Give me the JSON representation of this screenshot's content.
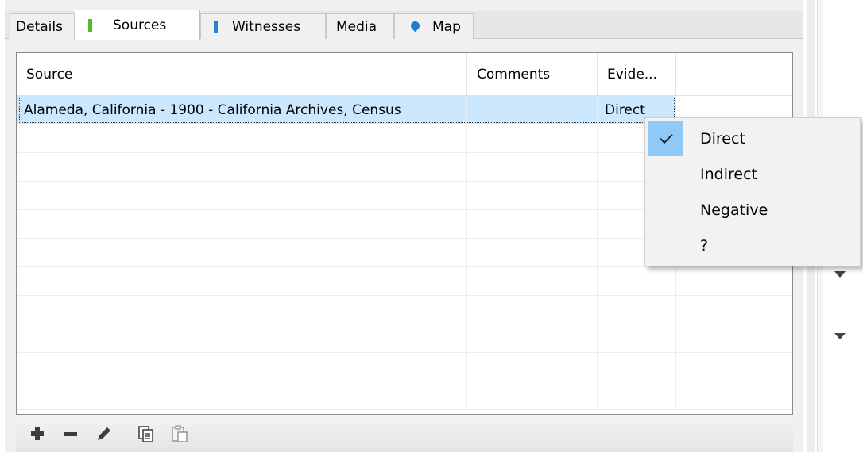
{
  "tabs": [
    {
      "label": "Details",
      "icon": "none",
      "active": false
    },
    {
      "label": "Sources",
      "icon": "green-bar-icon",
      "active": true
    },
    {
      "label": "Witnesses",
      "icon": "blue-bar-icon",
      "active": false
    },
    {
      "label": "Media",
      "icon": "none",
      "active": false
    },
    {
      "label": "Map",
      "icon": "map-pin-icon",
      "active": false
    }
  ],
  "grid": {
    "columns": [
      "Source",
      "Comments",
      "Evide..."
    ],
    "rows": [
      {
        "source": "Alameda, California - 1900 - California Archives, Census",
        "comments": "",
        "evidence": "Direct"
      }
    ]
  },
  "toolbar": {
    "icons": [
      "add-icon",
      "remove-icon",
      "edit-icon",
      "copy-icon",
      "paste-icon"
    ]
  },
  "popup_menu": {
    "items": [
      {
        "label": "Direct",
        "checked": true
      },
      {
        "label": "Indirect",
        "checked": false
      },
      {
        "label": "Negative",
        "checked": false
      },
      {
        "label": "?",
        "checked": false
      }
    ]
  },
  "colors": {
    "selection": "#cce8ff",
    "checked_highlight": "#90c8f6",
    "sources_icon": "#4cbf2f",
    "witnesses_icon": "#2f7fc7",
    "map_icon": "#1e7bd0"
  }
}
